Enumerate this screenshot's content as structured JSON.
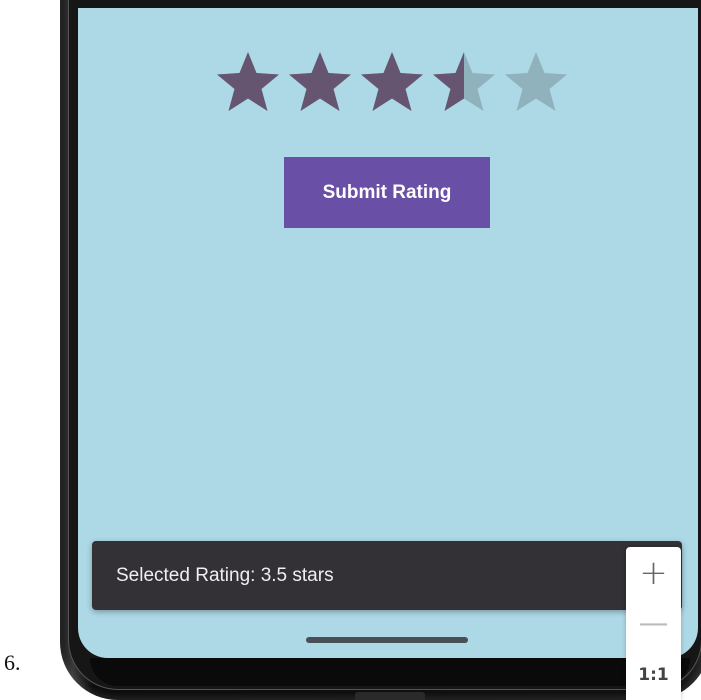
{
  "list_marker": "6.",
  "rating": {
    "value": 3.5,
    "max": 5,
    "filled_color": "#665570",
    "empty_color": "#8fb2bd"
  },
  "submit_label": "Submit Rating",
  "snackbar_text": "Selected Rating: 3.5 stars",
  "zoom": {
    "in_label": "+",
    "out_label": "—",
    "reset_label": "1:1"
  },
  "colors": {
    "screen_bg": "#add8e6",
    "button_bg": "#6a4fa6",
    "snackbar_bg": "#333036"
  }
}
